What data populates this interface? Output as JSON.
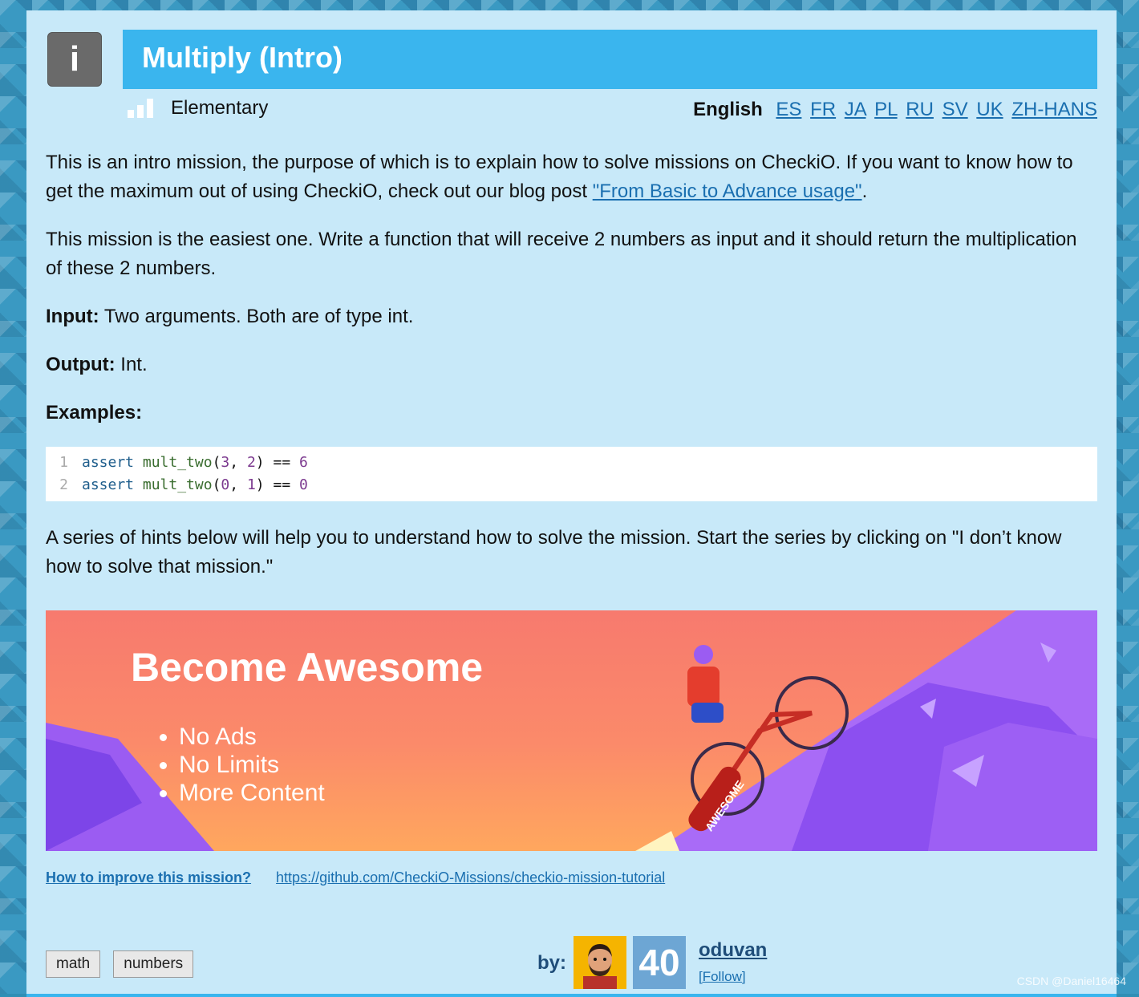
{
  "mission": {
    "info_icon_label": "i",
    "title": "Multiply (Intro)",
    "level": "Elementary"
  },
  "languages": {
    "current": "English",
    "others": [
      "ES",
      "FR",
      "JA",
      "PL",
      "RU",
      "SV",
      "UK",
      "ZH-HANS"
    ]
  },
  "description": {
    "p1_text": "This is an intro mission, the purpose of which is to explain how to solve missions on CheckiO. If you want to know how to get the maximum out of using CheckiO, check out our blog post ",
    "p1_link": "\"From Basic to Advance usage\"",
    "p1_end": ".",
    "p2": "This mission is the easiest one. Write a function that will receive 2 numbers as input and it should return the multiplication of these 2 numbers.",
    "input_label": "Input:",
    "input_text": " Two arguments. Both are of type int.",
    "output_label": "Output:",
    "output_text": " Int.",
    "examples_label": "Examples:",
    "hint_text": "A series of hints below will help you to understand how to solve the mission. Start the series by clicking on \"I don’t know how to solve that mission.\""
  },
  "code": {
    "lines": [
      {
        "num": "1",
        "kw": "assert",
        "fn": "mult_two",
        "open": "(",
        "a": "3",
        "sep": ", ",
        "b": "2",
        "close": ")",
        "op": " == ",
        "res": "6"
      },
      {
        "num": "2",
        "kw": "assert",
        "fn": "mult_two",
        "open": "(",
        "a": "0",
        "sep": ", ",
        "b": "1",
        "close": ")",
        "op": " == ",
        "res": "0"
      }
    ]
  },
  "banner": {
    "title": "Become Awesome",
    "items": [
      "No Ads",
      "No Limits",
      "More Content"
    ],
    "badge": "AWESOME"
  },
  "improve": {
    "question": "How to improve this mission?",
    "url": "https://github.com/CheckiO-Missions/checkio-mission-tutorial"
  },
  "tags": [
    "math",
    "numbers"
  ],
  "author": {
    "by_label": "by:",
    "score": "40",
    "name": "oduvan",
    "follow": "[Follow]"
  },
  "watermark": "CSDN @Daniel16464",
  "colors": {
    "card_bg": "#c8e9f9",
    "title_bar": "#3ab5ee",
    "link": "#1a6fb0",
    "score_bg": "#6da6d4"
  }
}
